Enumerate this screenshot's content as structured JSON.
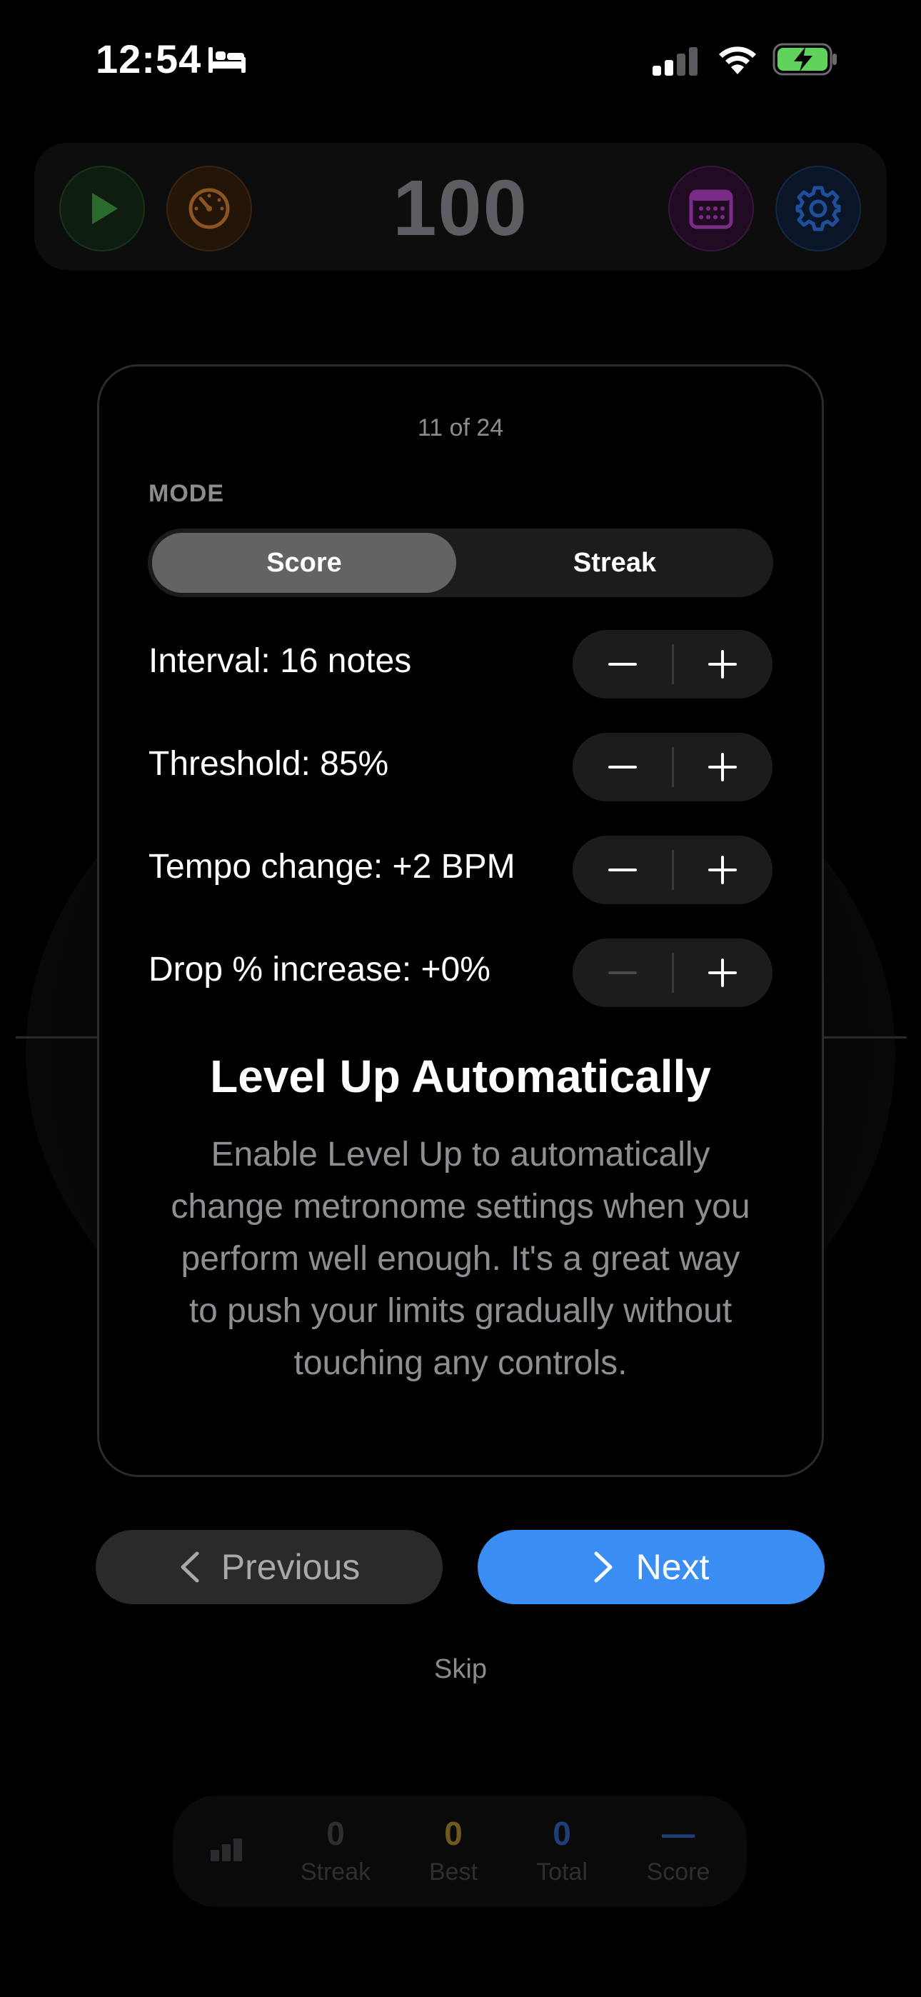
{
  "status_bar": {
    "time": "12:54"
  },
  "toolbar": {
    "bpm": "100"
  },
  "card": {
    "page_counter": "11 of 24",
    "mode_label": "MODE",
    "mode_options": [
      "Score",
      "Streak"
    ],
    "mode_selected": "Score",
    "settings": [
      {
        "label": "Interval: 16 notes",
        "minus_enabled": true,
        "plus_enabled": true
      },
      {
        "label": "Threshold: 85%",
        "minus_enabled": true,
        "plus_enabled": true
      },
      {
        "label": "Tempo change: +2 BPM",
        "minus_enabled": true,
        "plus_enabled": true
      },
      {
        "label": "Drop % increase: +0%",
        "minus_enabled": false,
        "plus_enabled": true
      }
    ],
    "title": "Level Up Automatically",
    "body": "Enable Level Up to automatically change metronome settings when you perform well enough. It's a great way to push your limits gradually without touching any controls."
  },
  "navigation": {
    "previous_label": "Previous",
    "next_label": "Next",
    "skip_label": "Skip"
  },
  "stats": {
    "streak_value": "0",
    "streak_label": "Streak",
    "best_value": "0",
    "best_label": "Best",
    "total_value": "0",
    "total_label": "Total",
    "score_value": "—",
    "score_label": "Score"
  },
  "colors": {
    "accent": "#3a8df2",
    "best": "#6e5a1e",
    "total": "#1f3f78",
    "score": "#1f3f78"
  }
}
